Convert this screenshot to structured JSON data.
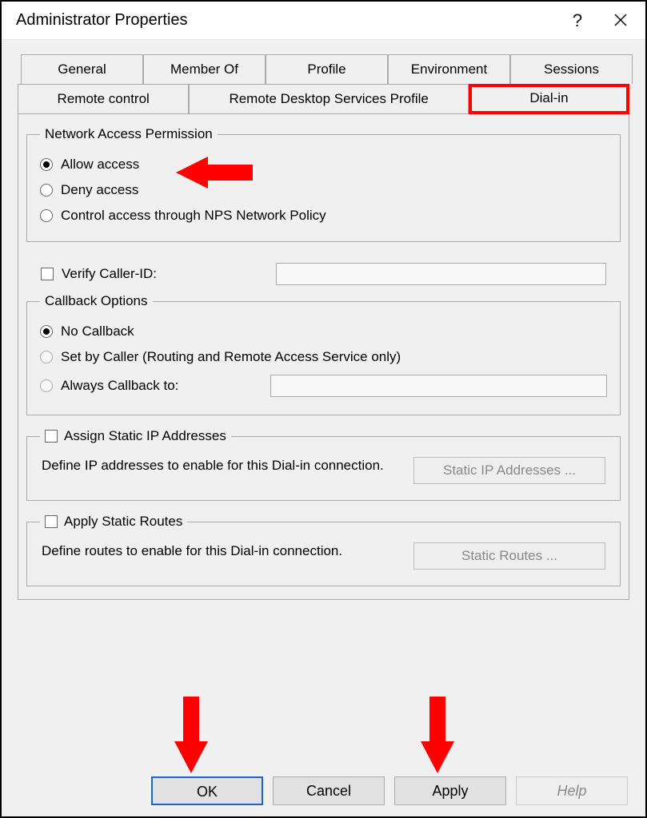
{
  "window": {
    "title": "Administrator Properties"
  },
  "tabs_row1": [
    "General",
    "Member Of",
    "Profile",
    "Environment",
    "Sessions"
  ],
  "tabs_row2": [
    "Remote control",
    "Remote Desktop Services Profile",
    "Dial-in"
  ],
  "groups": {
    "network_access": {
      "title": "Network Access Permission",
      "options": {
        "allow": "Allow access",
        "deny": "Deny access",
        "nps": "Control access through NPS Network Policy"
      },
      "selected": "allow"
    },
    "verify_caller": {
      "label": "Verify Caller-ID:"
    },
    "callback": {
      "title": "Callback Options",
      "options": {
        "none": "No Callback",
        "set_by_caller": "Set by Caller (Routing and Remote Access Service only)",
        "always": "Always Callback to:"
      },
      "selected": "none"
    },
    "static_ip": {
      "legend": "Assign Static IP Addresses",
      "desc": "Define IP addresses to enable for this Dial-in connection.",
      "button": "Static IP Addresses ..."
    },
    "static_routes": {
      "legend": "Apply Static Routes",
      "desc": "Define routes to enable for this Dial-in connection.",
      "button": "Static Routes ..."
    }
  },
  "buttons": {
    "ok": "OK",
    "cancel": "Cancel",
    "apply": "Apply",
    "help": "Help"
  }
}
